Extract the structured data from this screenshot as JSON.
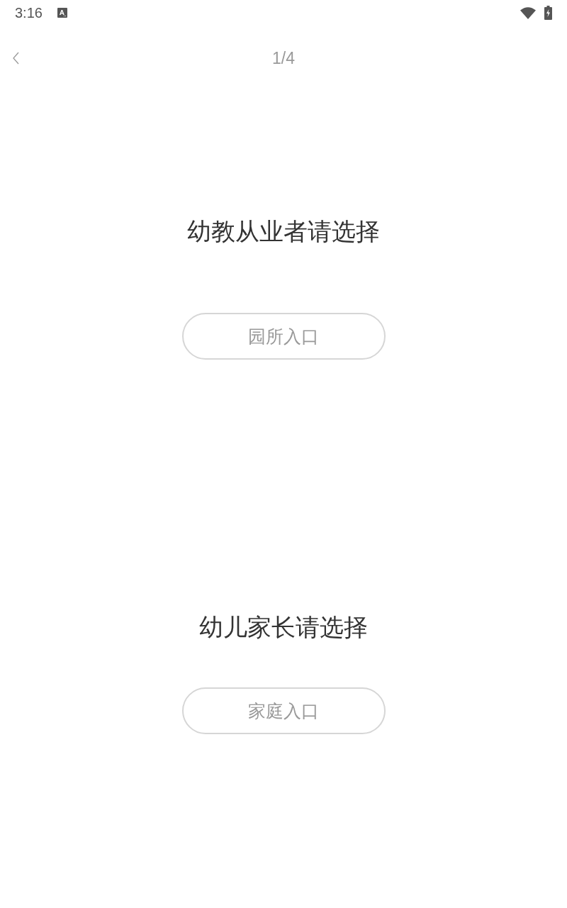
{
  "status_bar": {
    "time": "3:16"
  },
  "header": {
    "page_indicator": "1/4"
  },
  "sections": [
    {
      "title": "幼教从业者请选择",
      "button": "园所入口"
    },
    {
      "title": "幼儿家长请选择",
      "button": "家庭入口"
    }
  ]
}
